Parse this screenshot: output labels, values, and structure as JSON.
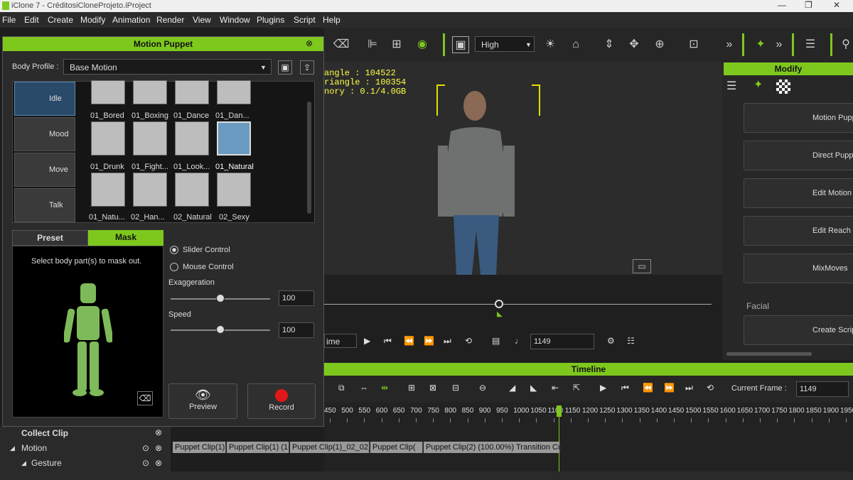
{
  "window": {
    "title": "iClone 7 - CréditosiCloneProjeto.iProject"
  },
  "menu": [
    "File",
    "Edit",
    "Create",
    "Modify",
    "Animation",
    "Render",
    "View",
    "Window",
    "Plugins",
    "Script",
    "Help"
  ],
  "toolbar": {
    "quality": "High"
  },
  "viewport": {
    "stats": [
      "angle : 104522",
      "riangle : 100354",
      "nory : 0.1/4.0GB"
    ],
    "frame": "1149",
    "time_label": "ime"
  },
  "motion_puppet": {
    "title": "Motion Puppet",
    "body_profile_label": "Body Profile :",
    "body_profile_value": "Base Motion",
    "categories": [
      "Idle",
      "Mood",
      "Move",
      "Talk"
    ],
    "thumbs": [
      "01_Bored",
      "01_Boxing",
      "01_Dance",
      "01_Dan...",
      "01_Drunk",
      "01_Fight...",
      "01_Look...",
      "01_Natural",
      "01_Natu...",
      "02_Han...",
      "02_Natural",
      "02_Sexy"
    ],
    "tabs": [
      "Preset",
      "Mask"
    ],
    "mask_hint": "Select body part(s) to mask out.",
    "slider_control": "Slider Control",
    "mouse_control": "Mouse Control",
    "exaggeration_label": "Exaggeration",
    "exaggeration_value": "100",
    "speed_label": "Speed",
    "speed_value": "100",
    "preview": "Preview",
    "record": "Record"
  },
  "modify": {
    "title": "Modify",
    "buttons": [
      "Motion Pupp",
      "Direct Pupp",
      "Edit Motion",
      "Edit Reach",
      "MixMoves"
    ],
    "facial": "Facial",
    "create_script": "Create Scrip"
  },
  "timeline": {
    "title": "Timeline",
    "current_frame_label": "Current Frame :",
    "current_frame": "1149",
    "ruler": [
      "450",
      "500",
      "550",
      "600",
      "650",
      "700",
      "750",
      "800",
      "850",
      "900",
      "950",
      "1000",
      "1050",
      "1100",
      "1150",
      "1200",
      "1250",
      "1300",
      "1350",
      "1400",
      "1450",
      "1500",
      "1550",
      "1600",
      "1650",
      "1700",
      "1750",
      "1800",
      "1850",
      "1900",
      "1950",
      "20"
    ],
    "collect_clip": "Collect Clip",
    "motion": "Motion",
    "gesture": "Gesture",
    "clips": [
      "Puppet Clip(1)(",
      "Puppet Clip(1) (1(",
      "Puppet Clip(1)_02_02_",
      "Puppet Clip(",
      "Puppet Clip(2) (100.00%) Transition Cu"
    ]
  }
}
